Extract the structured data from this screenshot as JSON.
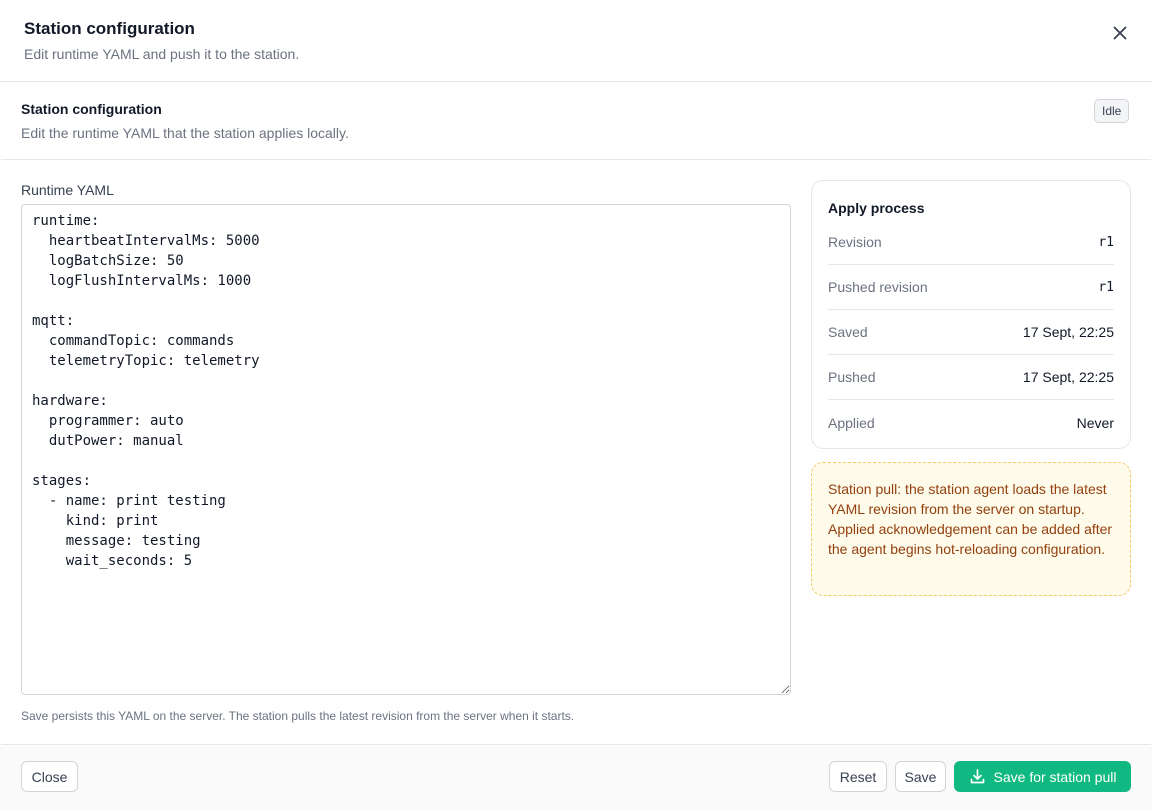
{
  "dialog": {
    "title": "Station configuration",
    "subtitle": "Edit runtime YAML and push it to the station."
  },
  "panel": {
    "title": "Station configuration",
    "subtitle": "Edit the runtime YAML that the station applies locally.",
    "status": "Idle"
  },
  "editor": {
    "label": "Runtime YAML",
    "content": "runtime:\n  heartbeatIntervalMs: 5000\n  logBatchSize: 50\n  logFlushIntervalMs: 1000\n\nmqtt:\n  commandTopic: commands\n  telemetryTopic: telemetry\n\nhardware:\n  programmer: auto\n  dutPower: manual\n\nstages:\n  - name: print testing\n    kind: print\n    message: testing\n    wait_seconds: 5",
    "help": "Save persists this YAML on the server. The station pulls the latest revision from the server when it starts."
  },
  "process": {
    "title": "Apply process",
    "rows": [
      {
        "key": "Revision",
        "value": "r1"
      },
      {
        "key": "Pushed revision",
        "value": "r1"
      },
      {
        "key": "Saved",
        "value": "17 Sept, 22:25"
      },
      {
        "key": "Pushed",
        "value": "17 Sept, 22:25"
      },
      {
        "key": "Applied",
        "value": "Never"
      }
    ]
  },
  "note": "Station pull: the station agent loads the latest YAML revision from the server on startup. Applied acknowledgement can be added after the agent begins hot-reloading configuration.",
  "footer": {
    "close_label": "Close",
    "reset_label": "Reset",
    "save_label": "Save",
    "save_pull_label": "Save for station pull"
  },
  "icons": {
    "close": "close-icon",
    "download": "download-icon"
  },
  "colors": {
    "accent": "#10b981",
    "note_bg": "#fffbeb",
    "note_text": "#92400e"
  }
}
